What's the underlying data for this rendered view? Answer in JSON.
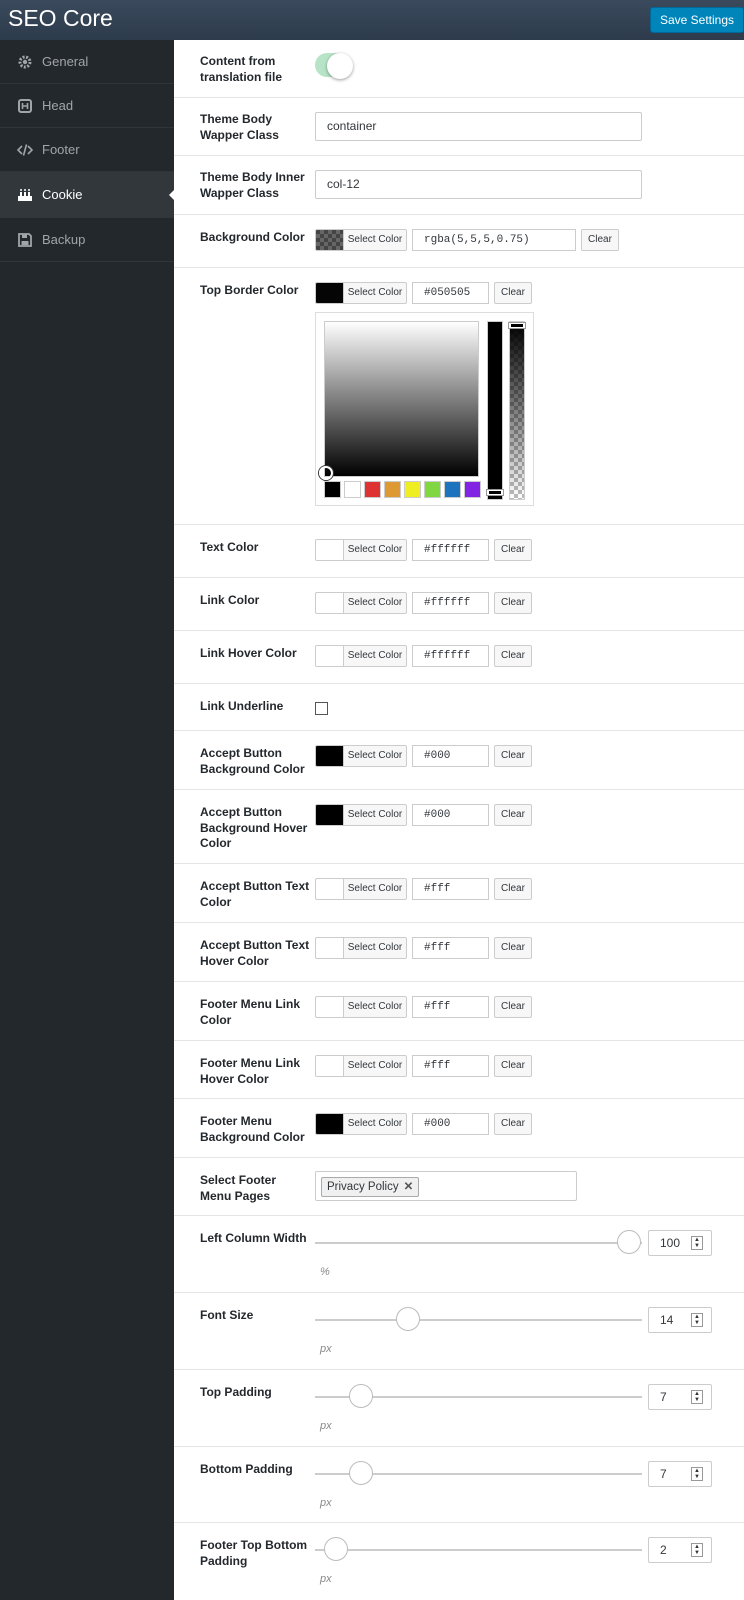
{
  "app": {
    "title": "SEO Core",
    "save_label": "Save Settings"
  },
  "sidebar": {
    "items": [
      {
        "label": "General",
        "icon": "gear-icon"
      },
      {
        "label": "Head",
        "icon": "head-icon"
      },
      {
        "label": "Footer",
        "icon": "code-icon"
      },
      {
        "label": "Cookie",
        "icon": "cookie-icon",
        "active": true
      },
      {
        "label": "Backup",
        "icon": "floppy-disk-icon"
      }
    ]
  },
  "form": {
    "content_from_translation": {
      "label": "Content from translation file",
      "enabled": true
    },
    "body_wrapper": {
      "label": "Theme Body Wapper Class",
      "value": "container"
    },
    "body_inner_wrapper": {
      "label": "Theme Body Inner Wapper Class",
      "value": "col-12"
    },
    "select_color_label": "Select Color",
    "clear_label": "Clear",
    "background_color": {
      "label": "Background Color",
      "value": "rgba(5,5,5,0.75)"
    },
    "top_border_color": {
      "label": "Top Border Color",
      "value": "#050505",
      "swatch": "#050505"
    },
    "picker": {
      "presets": [
        "#000000",
        "#ffffff",
        "#dd3333",
        "#dd9933",
        "#eeee22",
        "#81d742",
        "#1e73be",
        "#8224e3"
      ]
    },
    "text_color": {
      "label": "Text Color",
      "value": "#ffffff",
      "swatch": "#ffffff"
    },
    "link_color": {
      "label": "Link Color",
      "value": "#ffffff",
      "swatch": "#ffffff"
    },
    "link_hover_color": {
      "label": "Link Hover Color",
      "value": "#ffffff",
      "swatch": "#ffffff"
    },
    "link_underline": {
      "label": "Link Underline",
      "checked": false
    },
    "accept_bg": {
      "label": "Accept Button Background Color",
      "value": "#000",
      "swatch": "#000000"
    },
    "accept_bg_hover": {
      "label": "Accept Button Background Hover Color",
      "value": "#000",
      "swatch": "#000000"
    },
    "accept_text": {
      "label": "Accept Button Text Color",
      "value": "#fff",
      "swatch": "#ffffff"
    },
    "accept_text_hover": {
      "label": "Accept Button Text Hover Color",
      "value": "#fff",
      "swatch": "#ffffff"
    },
    "footer_link": {
      "label": "Footer Menu Link Color",
      "value": "#fff",
      "swatch": "#ffffff"
    },
    "footer_link_hover": {
      "label": "Footer Menu Link Hover Color",
      "value": "#fff",
      "swatch": "#ffffff"
    },
    "footer_bg": {
      "label": "Footer Menu Background Color",
      "value": "#000",
      "swatch": "#000000"
    },
    "footer_pages": {
      "label": "Select Footer Menu Pages",
      "tags": [
        "Privacy Policy"
      ]
    },
    "left_column_width": {
      "label": "Left Column Width",
      "value": "100",
      "unit": "%",
      "min": 0,
      "max": 100
    },
    "font_size": {
      "label": "Font Size",
      "value": "14",
      "unit": "px"
    },
    "top_padding": {
      "label": "Top Padding",
      "value": "7",
      "unit": "px"
    },
    "bottom_padding": {
      "label": "Bottom Padding",
      "value": "7",
      "unit": "px"
    },
    "footer_tb_padding": {
      "label": "Footer Top Bottom Padding",
      "value": "2",
      "unit": "px"
    }
  }
}
